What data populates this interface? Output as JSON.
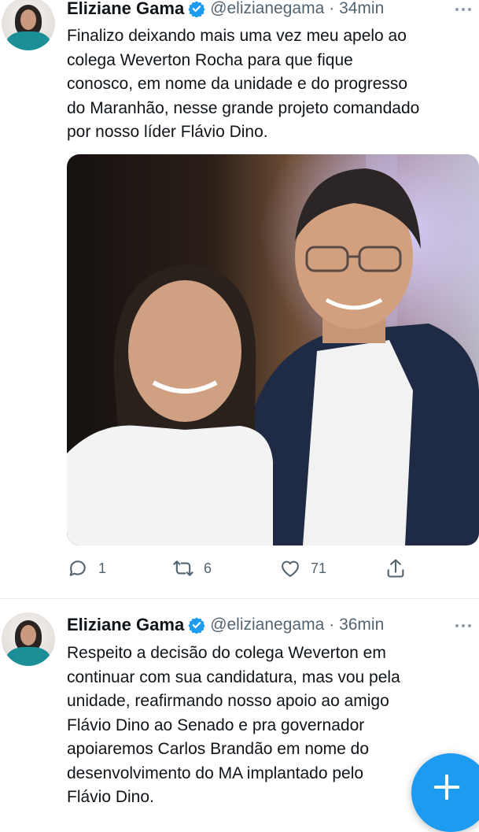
{
  "tweets": [
    {
      "author_name": "Eliziane Gama",
      "handle": "@elizianegama",
      "time": "· 34min",
      "text_lines": [
        "Finalizo deixando mais uma vez meu apelo ao",
        "colega Weverton Rocha para que fique",
        "conosco, em nome da unidade e do progresso",
        "do Maranhão, nesse grande projeto comandado",
        "por nosso líder Flávio Dino."
      ],
      "stats": {
        "replies": "1",
        "retweets": "6",
        "likes": "71"
      }
    },
    {
      "author_name": "Eliziane Gama",
      "handle": "@elizianegama",
      "time": "· 36min",
      "text_lines": [
        "Respeito a decisão do colega Weverton em",
        "continuar com sua candidatura, mas vou pela",
        "unidade, reafirmando nosso apoio ao amigo",
        "Flávio Dino ao Senado e pra governador",
        "apoiaremos Carlos Brandão em nome do",
        "desenvolvimento do MA implantado pelo",
        "Flávio Dino."
      ]
    }
  ],
  "icons": {
    "verified": "verified-badge-icon",
    "more": "more-icon",
    "reply": "reply-icon",
    "retweet": "retweet-icon",
    "like": "like-icon",
    "share": "share-icon",
    "compose": "compose-plus-icon"
  },
  "colors": {
    "accent": "#1d9bf0",
    "text": "#0f1419",
    "secondary": "#536471",
    "divider": "#e6ecf0"
  }
}
